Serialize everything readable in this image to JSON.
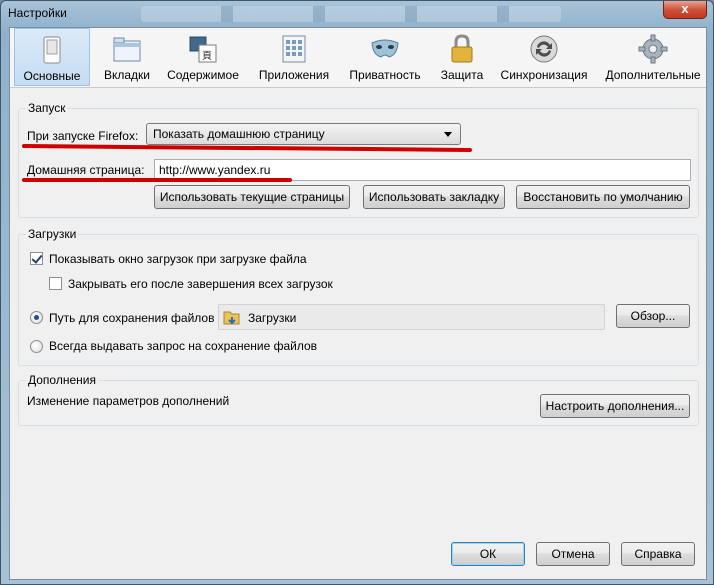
{
  "window": {
    "title": "Настройки",
    "close": "x"
  },
  "toolbar": {
    "items": [
      {
        "label": "Основные",
        "icon": "switch-icon"
      },
      {
        "label": "Вкладки",
        "icon": "tabs-window-icon"
      },
      {
        "label": "Содержимое",
        "icon": "content-icon"
      },
      {
        "label": "Приложения",
        "icon": "applications-icon"
      },
      {
        "label": "Приватность",
        "icon": "mask-icon"
      },
      {
        "label": "Защита",
        "icon": "padlock-icon"
      },
      {
        "label": "Синхронизация",
        "icon": "sync-icon"
      },
      {
        "label": "Дополнительные",
        "icon": "gear-icon"
      }
    ]
  },
  "startup": {
    "title": "Запуск",
    "when_starts_label": "При запуске Firefox:",
    "when_starts_value": "Показать домашнюю страницу",
    "homepage_label": "Домашняя страница:",
    "homepage_value": "http://www.yandex.ru",
    "btn_current": "Использовать текущие страницы",
    "btn_bookmark": "Использовать закладку",
    "btn_restore": "Восстановить по умолчанию"
  },
  "downloads": {
    "title": "Загрузки",
    "show_window": "Показывать окно загрузок при загрузке файла",
    "close_when_done": "Закрывать его после завершения всех загрузок",
    "save_path_label": "Путь для сохранения файлов",
    "folder": "Загрузки",
    "browse": "Обзор...",
    "always_ask": "Всегда выдавать запрос на сохранение файлов"
  },
  "addons": {
    "title": "Дополнения",
    "description": "Изменение параметров дополнений",
    "configure": "Настроить дополнения..."
  },
  "footer": {
    "ok": "ОК",
    "cancel": "Отмена",
    "help": "Справка"
  },
  "colors": {
    "annotation_red": "#d10000",
    "selected_tab": "#c4dcf2"
  }
}
